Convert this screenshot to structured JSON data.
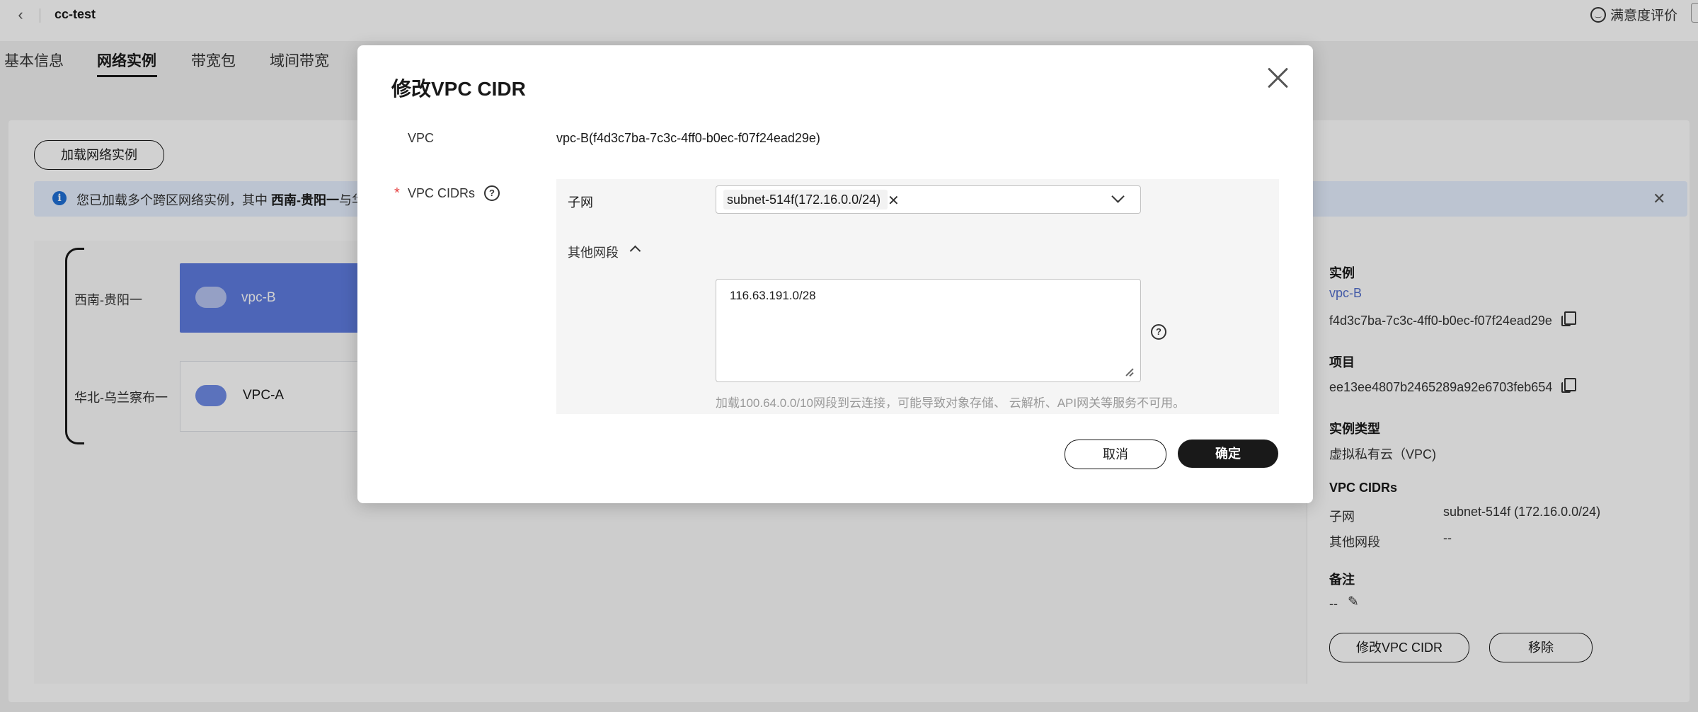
{
  "header": {
    "back_icon": "chevron-left-icon",
    "title": "cc-test",
    "satisfaction": "满意度评价"
  },
  "tabs": [
    {
      "label": "基本信息"
    },
    {
      "label": "网络实例",
      "active": true
    },
    {
      "label": "带宽包"
    },
    {
      "label": "域间带宽"
    }
  ],
  "toolbar": {
    "add_instance": "加载网络实例"
  },
  "info_bar": {
    "text_prefix": "您已加载多个跨区网络实例，其中 ",
    "text_bold": "西南-贵阳一",
    "text_suffix": "与华"
  },
  "topology": {
    "regions": [
      {
        "label": "西南-贵阳一",
        "vpc": "vpc-B"
      },
      {
        "label": "华北-乌兰察布一",
        "vpc": "VPC-A"
      }
    ],
    "colors": {
      "selected": "#5e7ce0"
    }
  },
  "detail": {
    "instance_title": "实例",
    "instance_name": "vpc-B",
    "instance_id": "f4d3c7ba-7c3c-4ff0-b0ec-f07f24ead29e",
    "project_title": "项目",
    "project_id": "ee13ee4807b2465289a92e6703feb654",
    "type_title": "实例类型",
    "type_value": "虚拟私有云（VPC)",
    "cidrs_title": "VPC CIDRs",
    "subnet_label": "子网",
    "subnet_value": "subnet-514f (172.16.0.0/24)",
    "other_label": "其他网段",
    "other_value": "--",
    "remark_title": "备注",
    "remark_value": "--",
    "modify_btn": "修改VPC CIDR",
    "remove_btn": "移除"
  },
  "modal": {
    "title": "修改VPC CIDR",
    "vpc_label": "VPC",
    "vpc_value": "vpc-B(f4d3c7ba-7c3c-4ff0-b0ec-f07f24ead29e)",
    "cidrs_label": "VPC CIDRs",
    "required_mark": "*",
    "subnet_label": "子网",
    "subnet_tag": "subnet-514f(172.16.0.0/24)",
    "other_label": "其他网段",
    "other_value": "116.63.191.0/28",
    "hint": "加载100.64.0.0/10网段到云连接，可能导致对象存储、 云解析、API网关等服务不可用。",
    "cancel": "取消",
    "confirm": "确定"
  }
}
